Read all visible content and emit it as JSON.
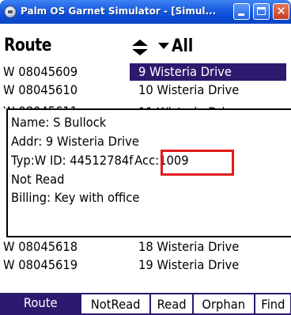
{
  "window": {
    "title": "Palm OS Garnet Simulator - [Simul...",
    "minimize_icon": "minimize-icon",
    "maximize_icon": "maximize-icon",
    "close_icon": "close-icon",
    "close_glyph": "✕"
  },
  "header": {
    "title": "Route",
    "sort_icon": "sort-up-down-icon",
    "filter_icon": "dropdown-arrow-icon",
    "filter_value": "All"
  },
  "rows_top": [
    {
      "meter": "W 08045609",
      "address": "9 Wisteria Drive",
      "selected": true
    },
    {
      "meter": "W 08045610",
      "address": "10 Wisteria Drive",
      "selected": false
    }
  ],
  "rows_bottom": [
    {
      "meter": "W 08045618",
      "address": "18 Wisteria Drive"
    },
    {
      "meter": "W 08045619",
      "address": "19 Wisteria Drive"
    }
  ],
  "popup": {
    "name": "Name: S Bullock",
    "addr": "Addr: 9 Wisteria Drive",
    "type_id": "Typ:W ID: 44512784f",
    "acc": "Acc:1009",
    "read_status": "Not Read",
    "billing": "Billing: Key with office"
  },
  "highlight_color": "#e21b1b",
  "selection_color": "#2b1a6e",
  "tabs": [
    {
      "label": "Route",
      "active": true
    },
    {
      "label": "NotRead",
      "active": false
    },
    {
      "label": "Read",
      "active": false
    },
    {
      "label": "Orphan",
      "active": false
    },
    {
      "label": "Find",
      "active": false
    }
  ]
}
